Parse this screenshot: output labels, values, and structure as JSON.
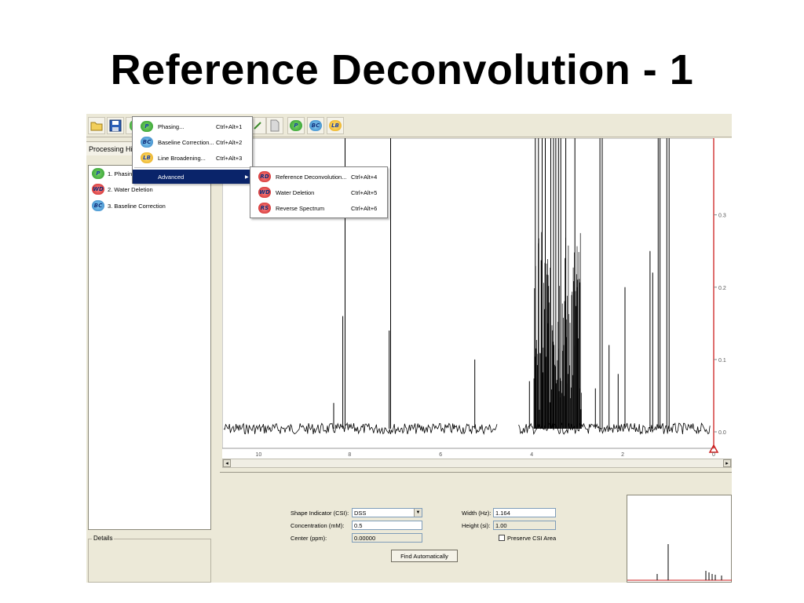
{
  "slide": {
    "title": "Reference Deconvolution - 1"
  },
  "toolbar": {
    "buttons": [
      {
        "icon": "open-folder-icon"
      },
      {
        "icon": "save-icon"
      },
      {
        "icon": "phasing-icon",
        "text": "P"
      },
      {
        "icon": "baseline-correction-icon",
        "text": "BC"
      },
      {
        "icon": "line-broadening-icon",
        "text": "LB"
      }
    ]
  },
  "left_panel": {
    "tab_label": "Processing History",
    "items": [
      {
        "label": "1. Phasing",
        "icon_text": "P"
      },
      {
        "label": "2. Water Deletion",
        "icon_text": "WD"
      },
      {
        "label": "3. Baseline Correction",
        "icon_text": "BC"
      }
    ],
    "details_label": "Details"
  },
  "menu": {
    "items": [
      {
        "label": "Phasing...",
        "shortcut": "Ctrl+Alt+1",
        "icon_text": "P"
      },
      {
        "label": "Baseline Correction...",
        "shortcut": "Ctrl+Alt+2",
        "icon_text": "BC"
      },
      {
        "label": "Line Broadening...",
        "shortcut": "Ctrl+Alt+3",
        "icon_text": "LB"
      },
      {
        "label": "Advanced",
        "submenu_arrow": "▶"
      }
    ]
  },
  "submenu": {
    "items": [
      {
        "label": "Reference Deconvolution...",
        "shortcut": "Ctrl+Alt+4",
        "icon_text": "RD"
      },
      {
        "label": "Water Deletion",
        "shortcut": "Ctrl+Alt+5",
        "icon_text": "WD"
      },
      {
        "label": "Reverse Spectrum",
        "shortcut": "Ctrl+Alt+6",
        "icon_text": "RS"
      }
    ]
  },
  "spectrum": {
    "x_ticks": [
      "10",
      "8",
      "6",
      "4",
      "2",
      "0"
    ],
    "y_ticks": [
      "0.3",
      "0.2",
      "0.1",
      "0.0"
    ],
    "reference_line_ppm": 0,
    "colors": {
      "trace": "#000000",
      "reference": "#cc1f1f",
      "axis": "#9a9a9a"
    }
  },
  "form": {
    "shape_indicator_label": "Shape Indicator (CSI):",
    "shape_indicator_value": "DSS",
    "concentration_label": "Concentration (mM):",
    "concentration_value": "0.5",
    "center_label": "Center (ppm):",
    "center_value": "0.00000",
    "width_label": "Width (Hz):",
    "width_value": "1.164",
    "height_label": "Height (si):",
    "height_value": "1.00",
    "preserve_label": "Preserve CSI Area",
    "find_button": "Find Automatically"
  },
  "scroll": {
    "left_arrow": "◂",
    "right_arrow": "▸"
  }
}
